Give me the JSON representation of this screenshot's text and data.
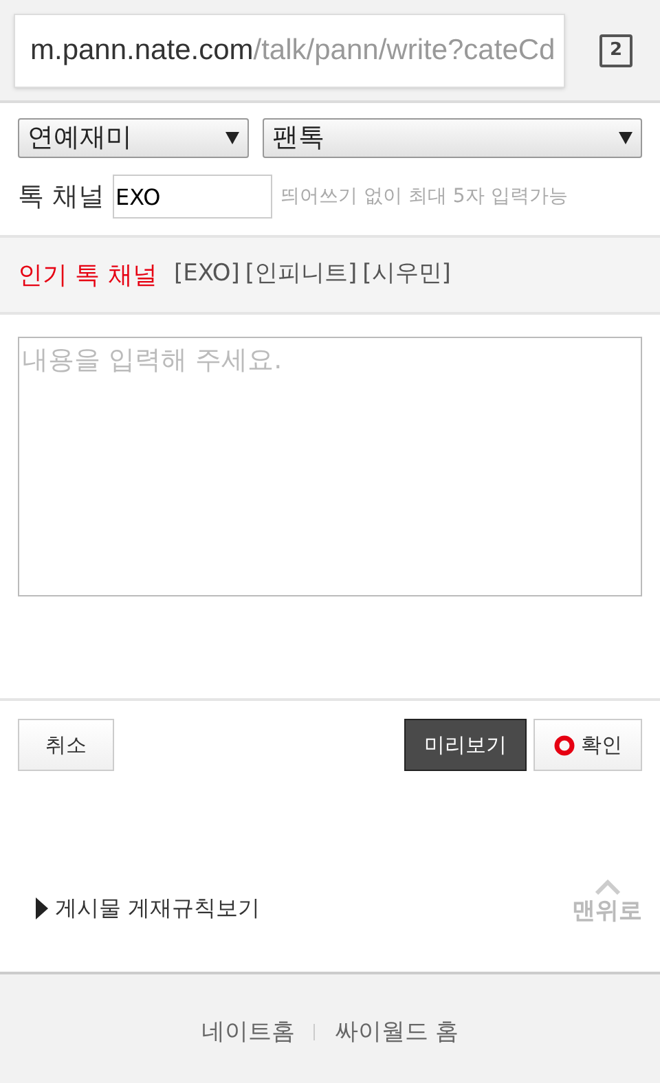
{
  "address_bar": {
    "host": "m.pann.nate.com",
    "path": "/talk/pann/write?cateCd",
    "tab_count": "2"
  },
  "category_selects": [
    {
      "value": "연예재미"
    },
    {
      "value": "팬톡"
    }
  ],
  "talk_channel": {
    "label": "톡 채널",
    "value": "EXO",
    "hint": "띄어쓰기 없이 최대 5자 입력가능"
  },
  "popular_channels": {
    "label": "인기 톡 채널",
    "items": [
      "[EXO]",
      "[인피니트]",
      "[시우민]"
    ]
  },
  "content": {
    "placeholder": "내용을 입력해 주세요."
  },
  "buttons": {
    "cancel": "취소",
    "preview": "미리보기",
    "confirm": "확인"
  },
  "rules_link": "게시물 게재규칙보기",
  "back_to_top": "맨위로",
  "footer_links": [
    "네이트홈",
    "싸이월드 홈"
  ]
}
